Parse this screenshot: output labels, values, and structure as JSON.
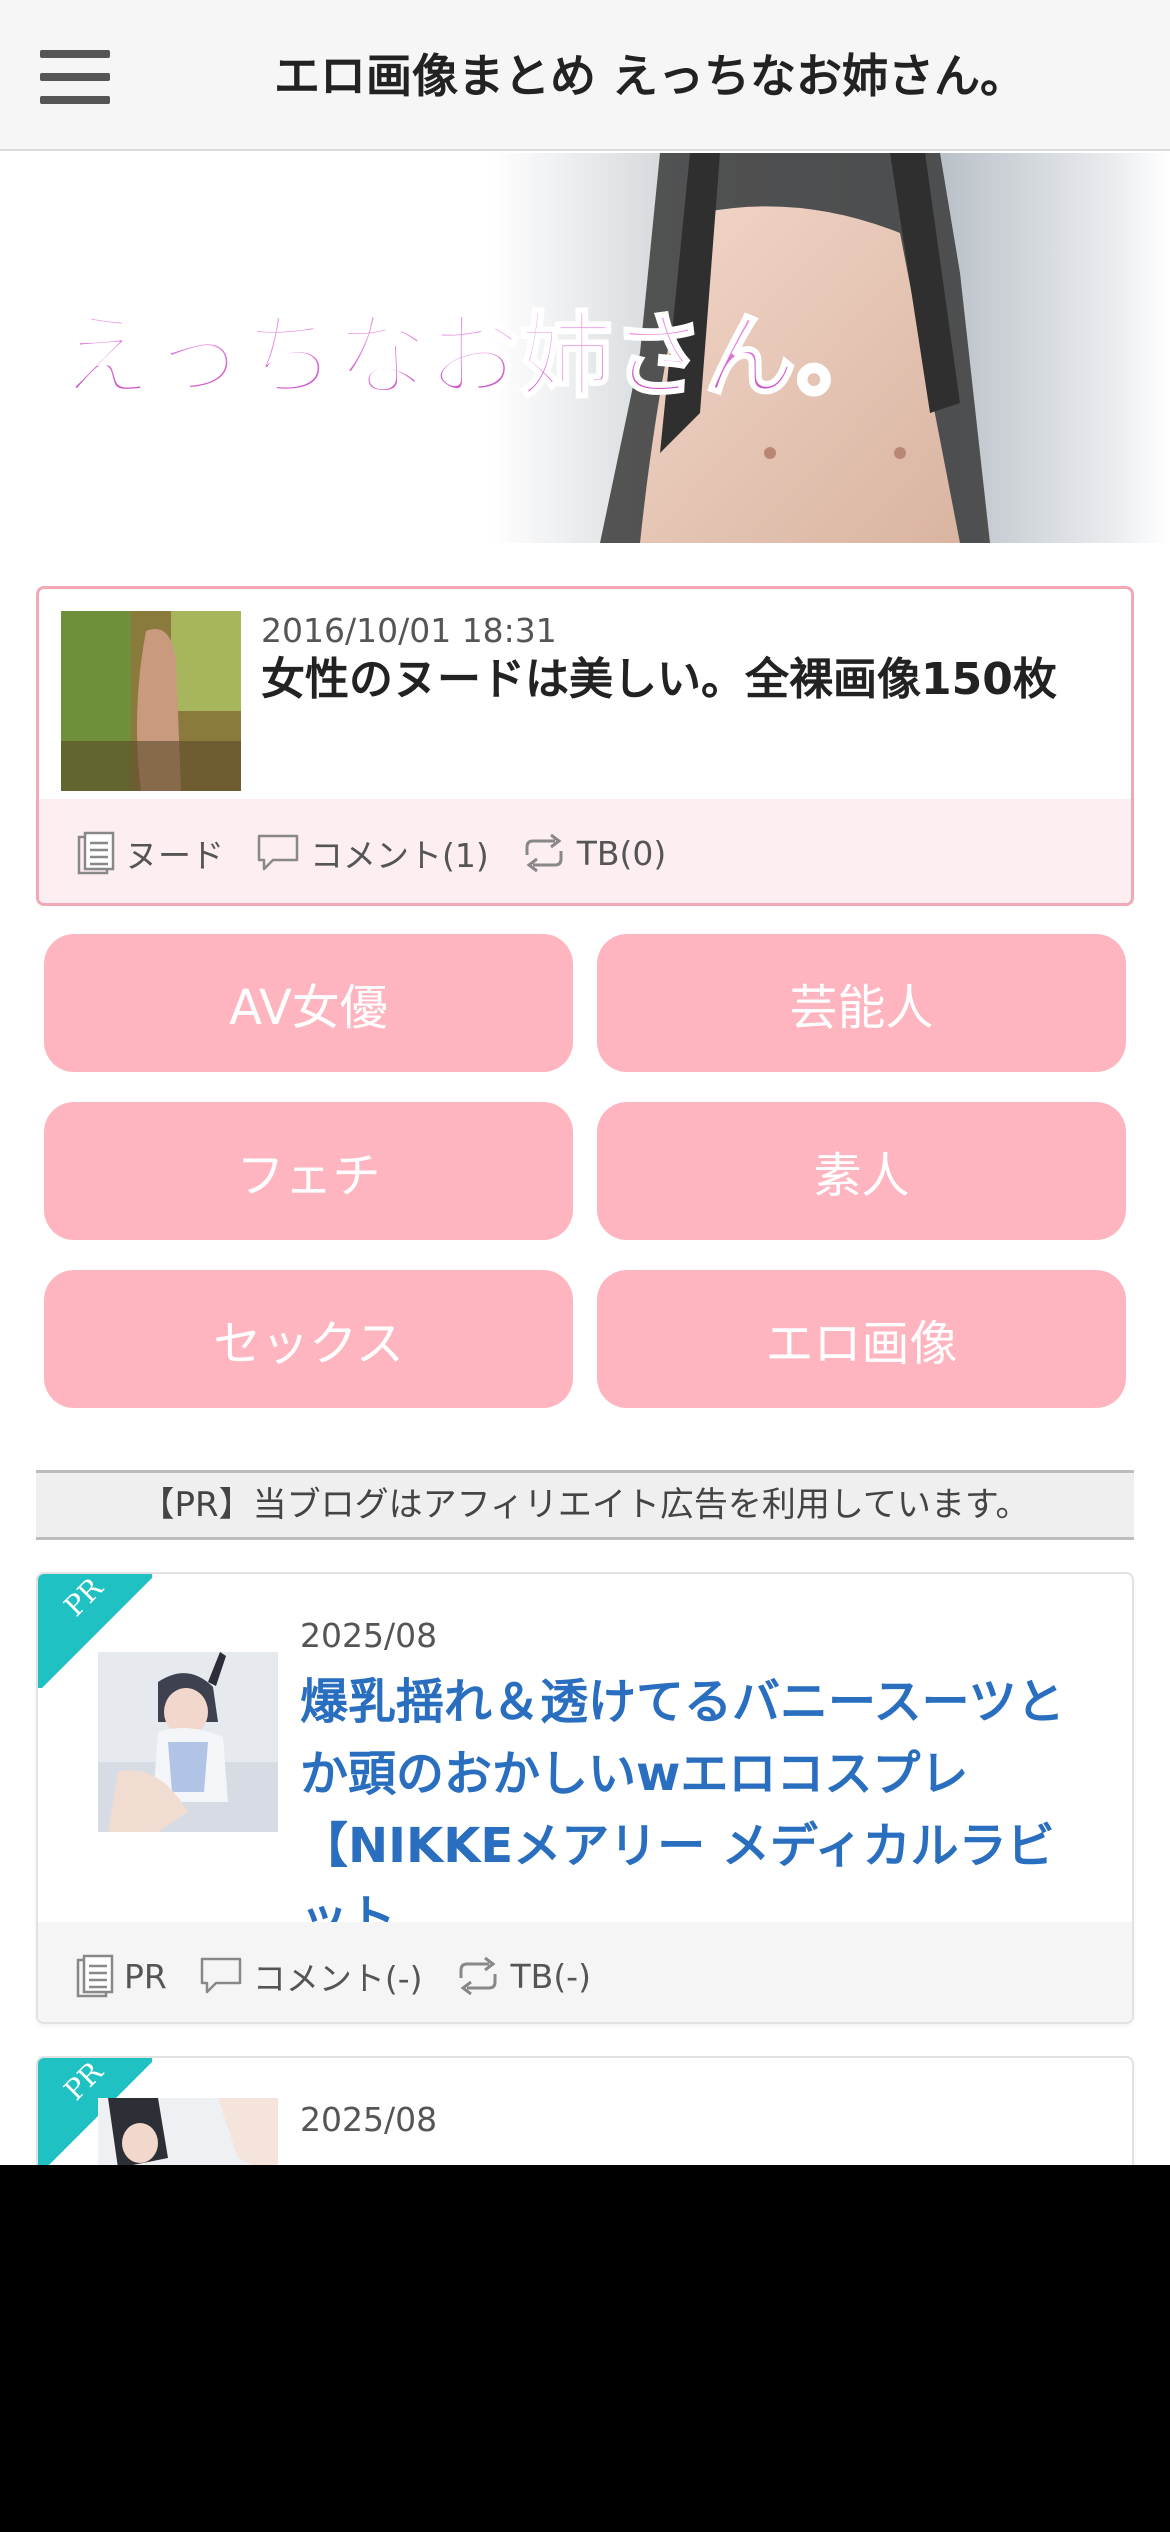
{
  "header": {
    "site_title": "エロ画像まとめ えっちなお姉さん。"
  },
  "banner": {
    "logo_text": "えっちなお姉さん。"
  },
  "featured_post": {
    "date": "2016/10/01 18:31",
    "title": "女性のヌードは美しい。全裸画像150枚",
    "category": "ヌード",
    "comments": "コメント(1)",
    "trackbacks": "TB(0)"
  },
  "categories": [
    {
      "label": "AV女優"
    },
    {
      "label": "芸能人"
    },
    {
      "label": "フェチ"
    },
    {
      "label": "素人"
    },
    {
      "label": "セックス"
    },
    {
      "label": "エロ画像"
    }
  ],
  "pr_notice": "【PR】当ブログはアフィリエイト広告を利用しています。",
  "ads": [
    {
      "ribbon": "PR",
      "date": "2025/08",
      "title": "爆乳揺れ＆透けてるバニースーツとか頭のおかしいwエロコスプレ【NIKKEメアリー メディカルラビット",
      "category": "PR",
      "comments": "コメント(-)",
      "trackbacks": "TB(-)"
    },
    {
      "ribbon": "PR",
      "date": "2025/08"
    }
  ],
  "colors": {
    "category_button": "#ffb5c0",
    "featured_border": "#f2a9b5",
    "ribbon": "#1fc1c3",
    "ad_title": "#2a6fbf"
  },
  "icons": {
    "menu": "hamburger-icon",
    "category": "document-icon",
    "comment": "comment-bubble-icon",
    "trackback": "repeat-arrows-icon"
  }
}
